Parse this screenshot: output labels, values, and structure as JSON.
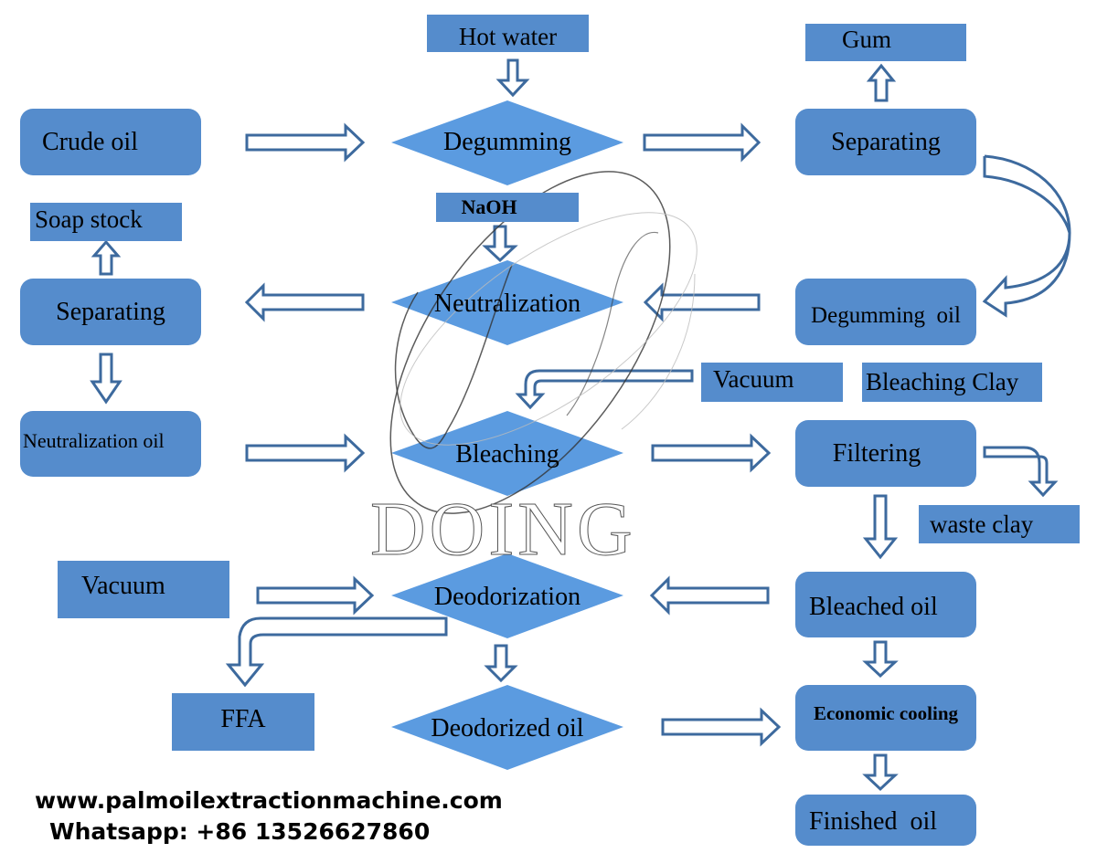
{
  "diagram": {
    "colors": {
      "box_fill": "#558ccc",
      "diamond_fill": "#5b9be0",
      "arrow_stroke": "#3d6a9e",
      "watermark_stroke": "#555555"
    },
    "inputs": {
      "hot_water": "Hot water",
      "gum": "Gum",
      "naoh": "NaOH",
      "soap_stock": "Soap stock",
      "vacuum_bleaching": "Vacuum",
      "bleaching_clay": "Bleaching Clay",
      "waste_clay": "waste clay",
      "vacuum_deodorization": "Vacuum",
      "ffa": "FFA"
    },
    "process_boxes": {
      "crude_oil": "Crude oil",
      "separating_1": "Separating",
      "degumming_oil": "Degumming  oil",
      "separating_2": "Separating",
      "neutralization_oil": "Neutralization oil",
      "filtering": "Filtering",
      "bleached_oil": "Bleached oil",
      "economic_cooling": "Economic cooling",
      "finished_oil": "Finished  oil"
    },
    "diamonds": {
      "degumming": "Degumming",
      "neutralization": "Neutralization",
      "bleaching": "Bleaching",
      "deodorization": "Deodorization",
      "deodorized_oil": "Deodorized oil"
    },
    "watermark": "DOING"
  },
  "footer": {
    "website": "www.palmoilextractionmachine.com",
    "whatsapp": "Whatsapp: +86 13526627860"
  }
}
